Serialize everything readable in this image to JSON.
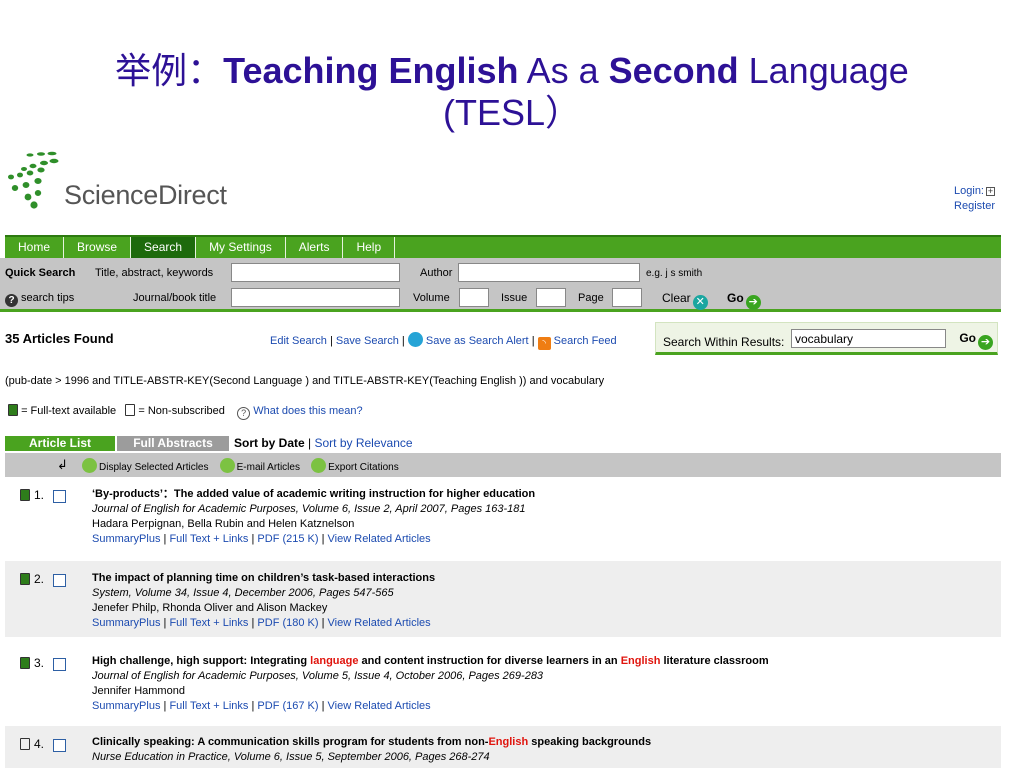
{
  "slide": {
    "title_prefix": "举例：",
    "title_b1": "Teaching English",
    "title_n1": " As a ",
    "title_b2": "Second",
    "title_n2": " Language",
    "title_line2": "(TESL）"
  },
  "brand": {
    "name": "ScienceDirect"
  },
  "account": {
    "login": "Login:",
    "register": "Register"
  },
  "nav": {
    "tabs": [
      "Home",
      "Browse",
      "Search",
      "My Settings",
      "Alerts",
      "Help"
    ],
    "active": "Search"
  },
  "quick_search": {
    "label": "Quick Search",
    "title_label": "Title, abstract, keywords",
    "author_label": "Author",
    "author_hint": "e.g. j s smith",
    "tips": "search tips",
    "journal_label": "Journal/book title",
    "volume_label": "Volume",
    "issue_label": "Issue",
    "page_label": "Page",
    "clear": "Clear",
    "go": "Go"
  },
  "results": {
    "count_text": "35 Articles Found",
    "edit_search": "Edit Search",
    "save_search": "Save Search",
    "save_alert": "Save as Search Alert",
    "search_feed": "Search Feed",
    "within_label": "Search Within Results:",
    "within_value": "vocabulary",
    "within_go": "Go",
    "query": "(pub-date > 1996 and TITLE-ABSTR-KEY(Second Language ) and TITLE-ABSTR-KEY(Teaching English )) and vocabulary"
  },
  "legend": {
    "full": "= Full-text available",
    "non": "= Non-subscribed",
    "what": "What does this mean?"
  },
  "view": {
    "article_list": "Article List",
    "full_abstracts": "Full Abstracts",
    "sort_by_date": "Sort by Date",
    "sort_by_relevance": "Sort by Relevance"
  },
  "actions": {
    "display": "Display Selected Articles",
    "email": "E-mail Articles",
    "export": "Export Citations"
  },
  "link_labels": {
    "summary": "SummaryPlus",
    "fulltext": "Full Text + Links",
    "related": "View Related Articles"
  },
  "articles": [
    {
      "num": "1.",
      "title": "‘By-products’：The added value of academic writing instruction for higher education",
      "journal": "Journal of English for Academic Purposes, Volume 6, Issue 2, April 2007, Pages 163-181",
      "authors": "Hadara Perpignan, Bella Rubin and Helen Katznelson",
      "pdf": "PDF (215 K)"
    },
    {
      "num": "2.",
      "title": "The impact of planning time on children’s task-based interactions",
      "journal": "System, Volume 34, Issue 4, December 2006, Pages 547-565",
      "authors": "Jenefer Philp, Rhonda Oliver and Alison Mackey",
      "pdf": "PDF (180 K)"
    },
    {
      "num": "3.",
      "title_a": "High challenge, high support: Integrating ",
      "title_hl1": "language",
      "title_b": " and content instruction for diverse learners in an ",
      "title_hl2": "English",
      "title_c": " literature classroom",
      "journal": "Journal of English for Academic Purposes, Volume 5, Issue 4, October 2006, Pages 269-283",
      "authors": "Jennifer Hammond",
      "pdf": "PDF (167 K)"
    },
    {
      "num": "4.",
      "title_a": "Clinically speaking: A communication skills program for students from non-",
      "title_hl1": "English",
      "title_b": " speaking backgrounds",
      "journal": "Nurse Education in Practice, Volume 6, Issue 5, September 2006, Pages 268-274"
    }
  ],
  "colors": {
    "nav_green": "#4aa31f",
    "title_purple": "#2d1196",
    "link_blue": "#1c4bb0",
    "highlight_red": "#e0140d"
  }
}
